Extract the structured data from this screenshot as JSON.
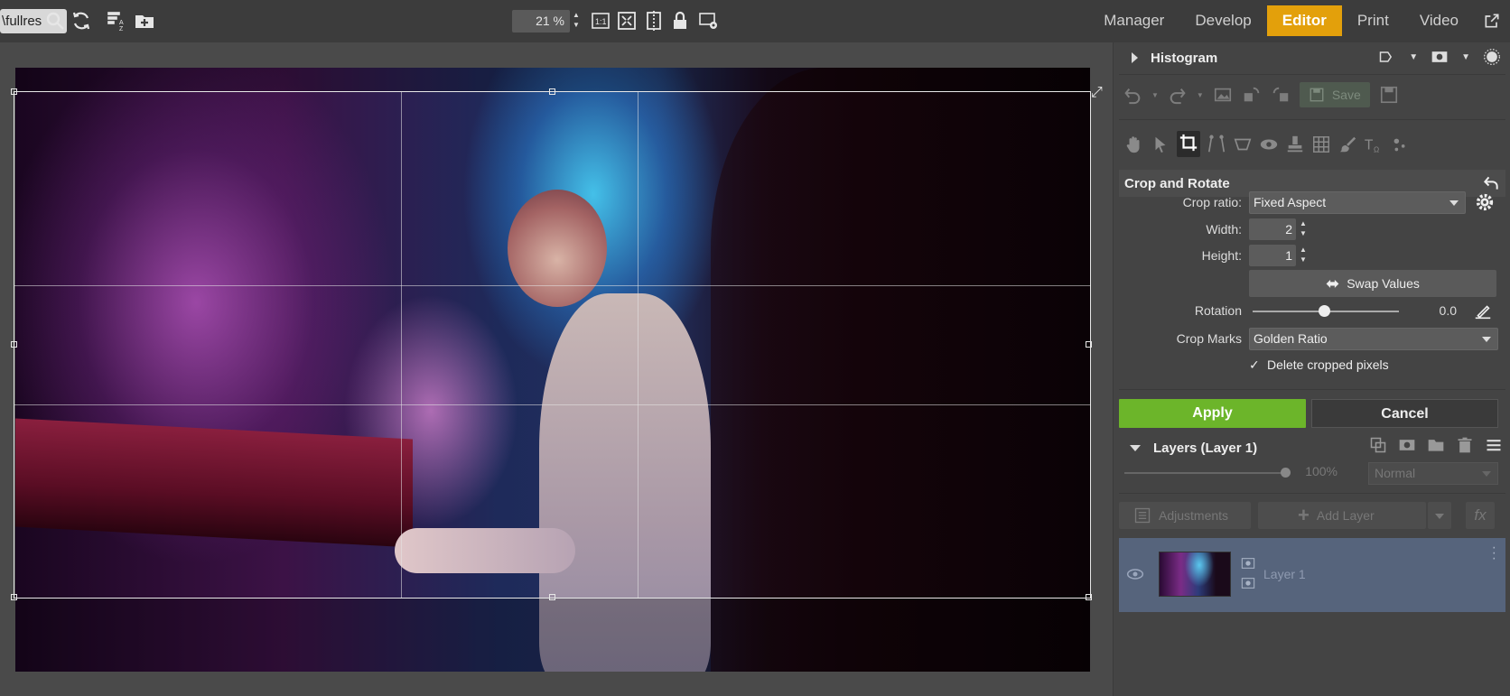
{
  "topbar": {
    "path_text": "\\fullres",
    "zoom_value": "21 %",
    "tools": [
      "search-icon",
      "refresh-icon",
      "sort-az-icon",
      "new-folder-icon",
      "actual-size-icon",
      "fit-to-screen-icon",
      "compare-icon",
      "lock-icon",
      "view-settings-icon"
    ],
    "actual_size_label": "1:1"
  },
  "modes": {
    "tabs": [
      {
        "label": "Manager",
        "active": false
      },
      {
        "label": "Develop",
        "active": false
      },
      {
        "label": "Editor",
        "active": true
      },
      {
        "label": "Print",
        "active": false
      },
      {
        "label": "Video",
        "active": false
      }
    ],
    "accent": "#e3a00b"
  },
  "panel": {
    "histogram_title": "Histogram",
    "save_label": "Save",
    "crop": {
      "title": "Crop and Rotate",
      "crop_ratio_label": "Crop ratio:",
      "crop_ratio_value": "Fixed Aspect",
      "width_label": "Width:",
      "width_value": "2",
      "height_label": "Height:",
      "height_value": "1",
      "swap_label": "Swap Values",
      "rotation_label": "Rotation",
      "rotation_value": "0.0",
      "rotation_level": 0.5,
      "crop_marks_label": "Crop Marks",
      "crop_marks_value": "Golden Ratio",
      "delete_label": "Delete cropped pixels",
      "delete_checked": true,
      "apply_label": "Apply",
      "cancel_label": "Cancel",
      "apply_color": "#6cb52a"
    },
    "layers": {
      "title": "Layers (Layer 1)",
      "opacity_value": "100%",
      "blend_mode": "Normal",
      "adjustments_label": "Adjustments",
      "add_layer_label": "Add Layer",
      "fx_label": "fx",
      "items": [
        {
          "name": "Layer 1",
          "visible": true
        }
      ]
    }
  }
}
